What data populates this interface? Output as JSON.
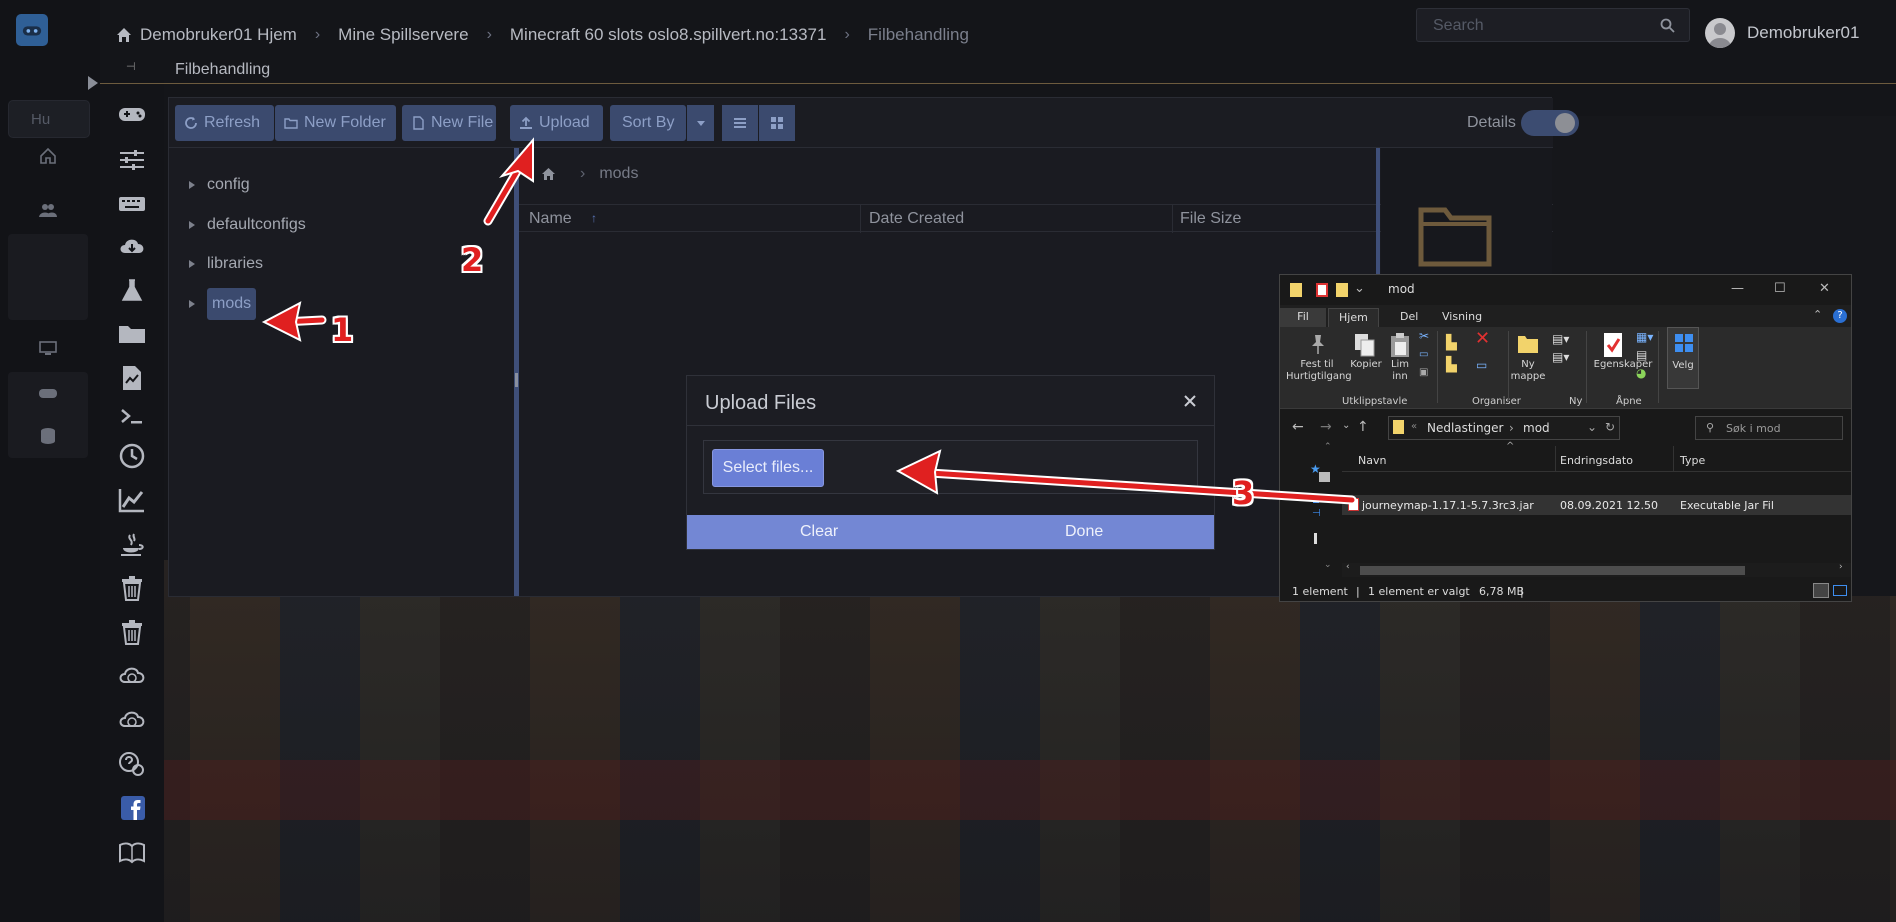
{
  "topbar": {
    "breadcrumbs": [
      {
        "label": "Demobruker01 Hjem"
      },
      {
        "label": "Mine Spillservere"
      },
      {
        "label": "Minecraft 60 slots oslo8.spillvert.no:13371"
      },
      {
        "label": "Filbehandling"
      }
    ],
    "notification_count": "0",
    "username": "Demobruker01"
  },
  "page_title": "Filbehandling",
  "sidebar": {
    "search_placeholder": "Hu"
  },
  "file_manager": {
    "toolbar": {
      "refresh": "Refresh",
      "new_folder": "New Folder",
      "new_file": "New File",
      "upload": "Upload",
      "sort_by": "Sort By",
      "details_label": "Details",
      "details_enabled": true,
      "search_placeholder": "Search"
    },
    "tree": [
      {
        "label": "config",
        "selected": false
      },
      {
        "label": "defaultconfigs",
        "selected": false
      },
      {
        "label": "libraries",
        "selected": false
      },
      {
        "label": "mods",
        "selected": true
      }
    ],
    "path": [
      "mods"
    ],
    "columns": [
      "Name",
      "Date Created",
      "File Size"
    ]
  },
  "upload_modal": {
    "title": "Upload Files",
    "select_button": "Select files...",
    "clear_button": "Clear",
    "done_button": "Done"
  },
  "explorer": {
    "title": "mod",
    "tabs": [
      "Fil",
      "Hjem",
      "Del",
      "Visning"
    ],
    "active_tab": "Hjem",
    "ribbon": {
      "pin_label_1": "Fest til",
      "pin_label_2": "Hurtigtilgang",
      "copy": "Kopier",
      "paste_1": "Lim",
      "paste_2": "inn",
      "group_clipboard": "Utklippstavle",
      "group_organize": "Organiser",
      "new_folder_1": "Ny",
      "new_folder_2": "mappe",
      "group_new": "Ny",
      "properties": "Egenskaper",
      "group_open": "Åpne",
      "select": "Velg"
    },
    "address": {
      "parent": "Nedlastinger",
      "current": "mod"
    },
    "search_placeholder": "Søk i mod",
    "columns": {
      "name": "Navn",
      "date": "Endringsdato",
      "type": "Type"
    },
    "files": [
      {
        "name": "journeymap-1.17.1-5.7.3rc3.jar",
        "date": "08.09.2021 12.50",
        "type": "Executable Jar Fil"
      }
    ],
    "status": {
      "count": "1 element",
      "selected": "1 element er valgt",
      "size": "6,78 MB"
    }
  },
  "annotations": {
    "step1": "1",
    "step2": "2",
    "step3": "3"
  },
  "colors": {
    "accent": "#3b4a6e",
    "modal_accent": "#7387d4",
    "arrow": "#e02020"
  }
}
